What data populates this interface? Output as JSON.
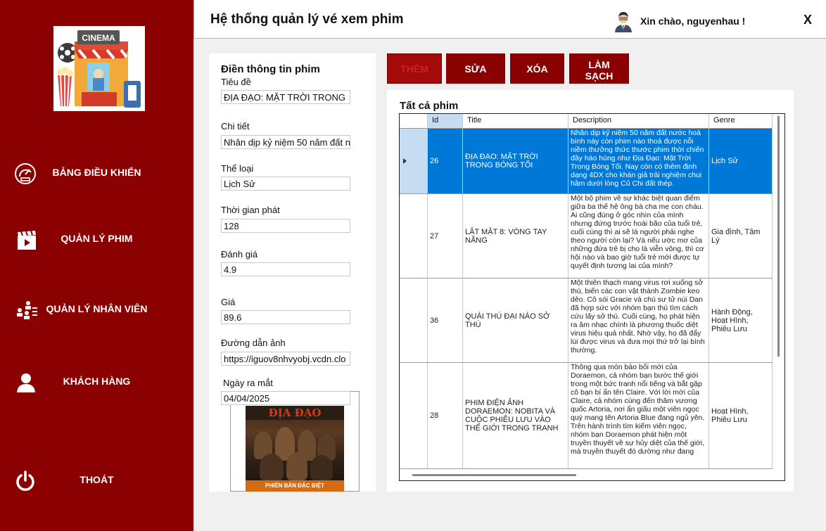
{
  "sidebar": {
    "logo_text": "CINEMA",
    "items": [
      {
        "label": "BẢNG ĐIỀU KHIỂN",
        "icon": "dashboard-gauge-icon"
      },
      {
        "label": "QUẢN LÝ PHIM",
        "icon": "film-clapper-icon"
      },
      {
        "label": "QUẢN LÝ NHÂN VIÊN",
        "icon": "staff-group-icon"
      },
      {
        "label": "KHÁCH HÀNG",
        "icon": "customer-user-icon"
      },
      {
        "label": "THOÁT",
        "icon": "power-icon"
      }
    ]
  },
  "header": {
    "title": "Hệ thống quản lý vé xem phim",
    "greeting": "Xin chào, nguyenhau !",
    "close_label": "X"
  },
  "form": {
    "title": "Điền thông tin phim",
    "fields": {
      "title": {
        "label": "Tiêu đề",
        "value": "ĐỊA ĐẠO: MẶT TRỜI TRONG"
      },
      "detail": {
        "label": "Chi tiết",
        "value": "Nhân dịp kỷ niệm 50 năm đất n"
      },
      "genre": {
        "label": "Thể loại",
        "value": "Lịch Sử"
      },
      "duration": {
        "label": "Thời gian phát",
        "value": "128"
      },
      "rating": {
        "label": "Đánh giá",
        "value": "4.9"
      },
      "price": {
        "label": "Giá",
        "value": "89.6"
      },
      "image_url": {
        "label": "Đường dẫn ảnh",
        "value": "https://iguov8nhvyobj.vcdn.clo"
      },
      "release_date": {
        "label": "Ngày ra mắt",
        "value": "04/04/2025"
      }
    },
    "poster": {
      "title": "ĐỊA ĐẠO",
      "band": "PHIÊN BẢN ĐẶC BIỆT"
    }
  },
  "actions": {
    "add": "THÊM",
    "edit": "SỬA",
    "delete": "XÓA",
    "clear_line1": "LÀM",
    "clear_line2": "SẠCH"
  },
  "table": {
    "title": "Tất cả phim",
    "columns": [
      "Id",
      "Title",
      "Description",
      "Genre"
    ],
    "rows": [
      {
        "id": "26",
        "title": "ĐỊA ĐẠO: MẶT TRỜI TRONG BÓNG TỐI",
        "description": "Nhân dịp kỷ niệm 50 năm đất nước hoà bình này còn phim nào thoả được nỗi niềm thưởng thức thước phim thời chiến đầy hào hùng như Địa Đạo: Mặt Trời Trong Bóng Tối. Nay còn có thêm định dạng 4DX cho khán giả trải nghiệm chui hầm dưới lòng Củ Chi đất thép.",
        "genre": "Lịch Sử"
      },
      {
        "id": "27",
        "title": "LẬT MẶT 8: VÒNG TAY NẮNG",
        "description": "Một bộ phim về sự khác biệt quan điểm giữa ba thế hệ ông bà cha mẹ con cháu. Ai cũng đúng ở góc nhìn của mình nhưng đứng trước hoài bão của tuổi trẻ, cuối cùng thì ai sẽ là người phải nghe theo người còn lại? Và nếu ước mơ của những đứa trẻ bị cho là viễn vông, thì cơ hội nào và bao giờ tuổi trẻ mới được tự quyết định tương lai của mình?",
        "genre": "Gia đình, Tâm Lý"
      },
      {
        "id": "36",
        "title": "QUÁI THÚ ĐẠI NÁO SỞ THÚ",
        "description": "Một thiên thạch mang virus rơi xuống sở thú, biến các con vật thành Zombie keo dẻo. Cô sói Gracie và chú sư tử núi Dan đã hợp sức với nhóm bạn thú tìm cách cứu lấy sở thú. Cuối cùng, họ phát hiện ra âm nhạc chính là phương thuốc diệt virus hiệu quả nhất. Nhờ vậy, họ đã đẩy lùi được virus và đưa mọi thứ trở lại bình thường.",
        "genre": "Hành Động, Hoạt Hình, Phiêu Lưu"
      },
      {
        "id": "28",
        "title": "PHIM ĐIỆN ẢNH DORAEMON: NOBITA VÀ CUỘC PHIÊU LƯU VÀO THẾ GIỚI TRONG TRANH",
        "description": "Thông qua món bảo bối mới của Doraemon, cả nhóm bạn bước thế giới trong một bức tranh nổi tiếng và bắt gặp cô bạn bí ẩn tên Claire. Với lời mời của Claire, cả nhóm cùng đến thăm vương quốc Artoria, nơi ẩn giấu một viên ngọc quý mang tên Artoria Blue đang ngủ yên. Trên hành trình tìm kiếm viên ngọc, nhóm bạn Doraemon phát hiện một truyền thuyết về sự hủy diệt của thế giới, mà truyền thuyết đó dường như đang",
        "genre": "Hoạt Hình, Phiêu Lưu"
      }
    ]
  },
  "colors": {
    "sidebar": "#8b0000",
    "selected_row": "#0078d7",
    "header_selected": "#c6dcf3"
  }
}
